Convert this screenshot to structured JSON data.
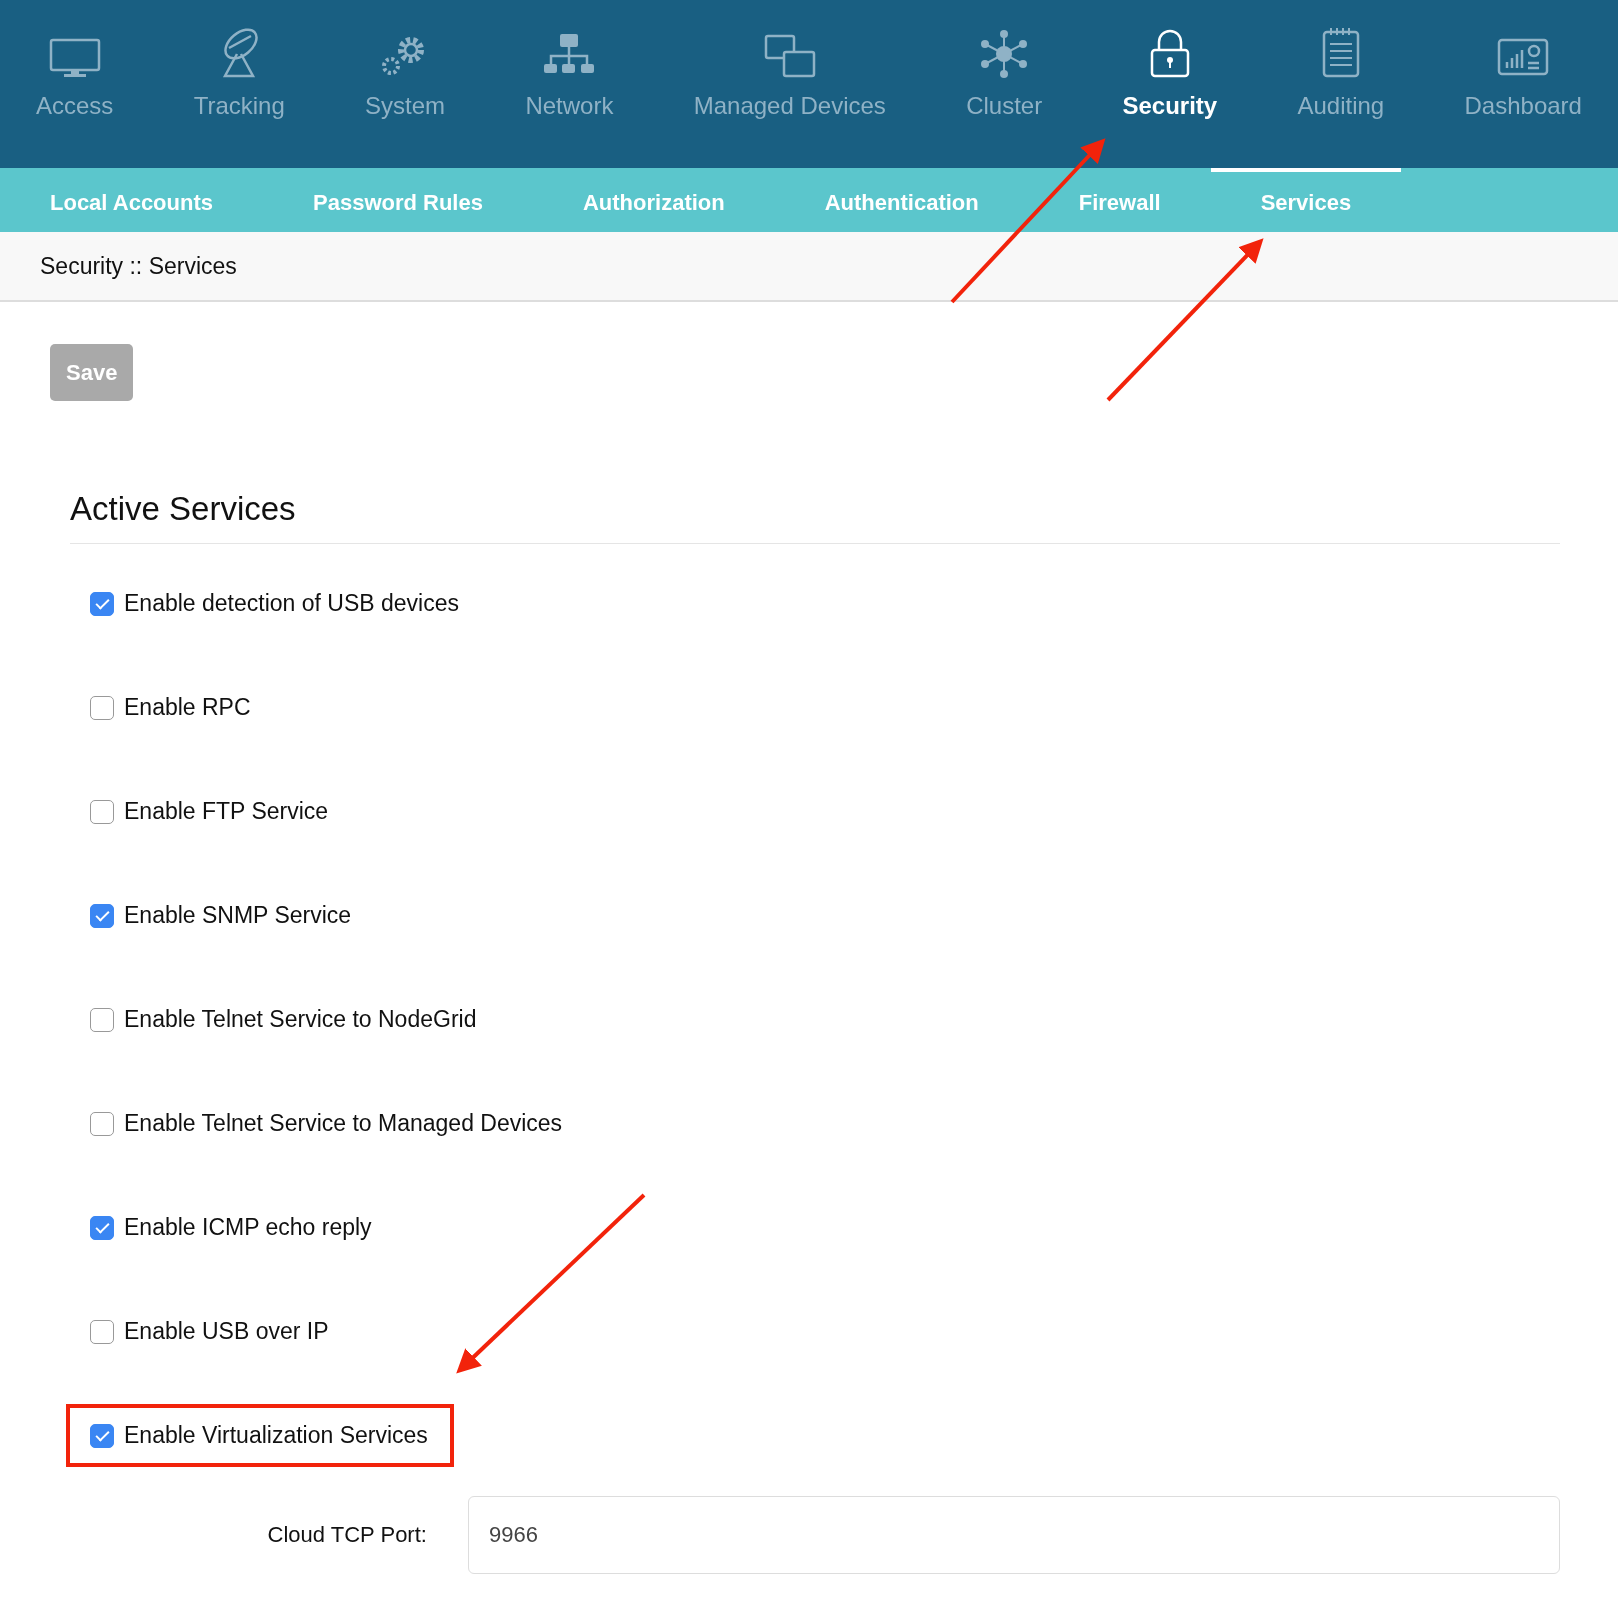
{
  "top_nav": [
    {
      "label": "Access",
      "selected": false
    },
    {
      "label": "Tracking",
      "selected": false
    },
    {
      "label": "System",
      "selected": false
    },
    {
      "label": "Network",
      "selected": false
    },
    {
      "label": "Managed Devices",
      "selected": false
    },
    {
      "label": "Cluster",
      "selected": false
    },
    {
      "label": "Security",
      "selected": true
    },
    {
      "label": "Auditing",
      "selected": false
    },
    {
      "label": "Dashboard",
      "selected": false
    }
  ],
  "sub_nav": [
    {
      "label": "Local Accounts",
      "selected": false
    },
    {
      "label": "Password Rules",
      "selected": false
    },
    {
      "label": "Authorization",
      "selected": false
    },
    {
      "label": "Authentication",
      "selected": false
    },
    {
      "label": "Firewall",
      "selected": false
    },
    {
      "label": "Services",
      "selected": true
    }
  ],
  "breadcrumb": "Security :: Services",
  "save_button": {
    "label": "Save",
    "disabled": true
  },
  "section_title": "Active Services",
  "services": [
    {
      "label": "Enable detection of USB devices",
      "checked": true,
      "highlighted": false
    },
    {
      "label": "Enable RPC",
      "checked": false,
      "highlighted": false
    },
    {
      "label": "Enable FTP Service",
      "checked": false,
      "highlighted": false
    },
    {
      "label": "Enable SNMP Service",
      "checked": true,
      "highlighted": false
    },
    {
      "label": "Enable Telnet Service to NodeGrid",
      "checked": false,
      "highlighted": false
    },
    {
      "label": "Enable Telnet Service to Managed Devices",
      "checked": false,
      "highlighted": false
    },
    {
      "label": "Enable ICMP echo reply",
      "checked": true,
      "highlighted": false
    },
    {
      "label": "Enable USB over IP",
      "checked": false,
      "highlighted": false
    },
    {
      "label": "Enable Virtualization Services",
      "checked": true,
      "highlighted": true
    }
  ],
  "port_field": {
    "label": "Cloud TCP Port:",
    "value": "9966"
  }
}
